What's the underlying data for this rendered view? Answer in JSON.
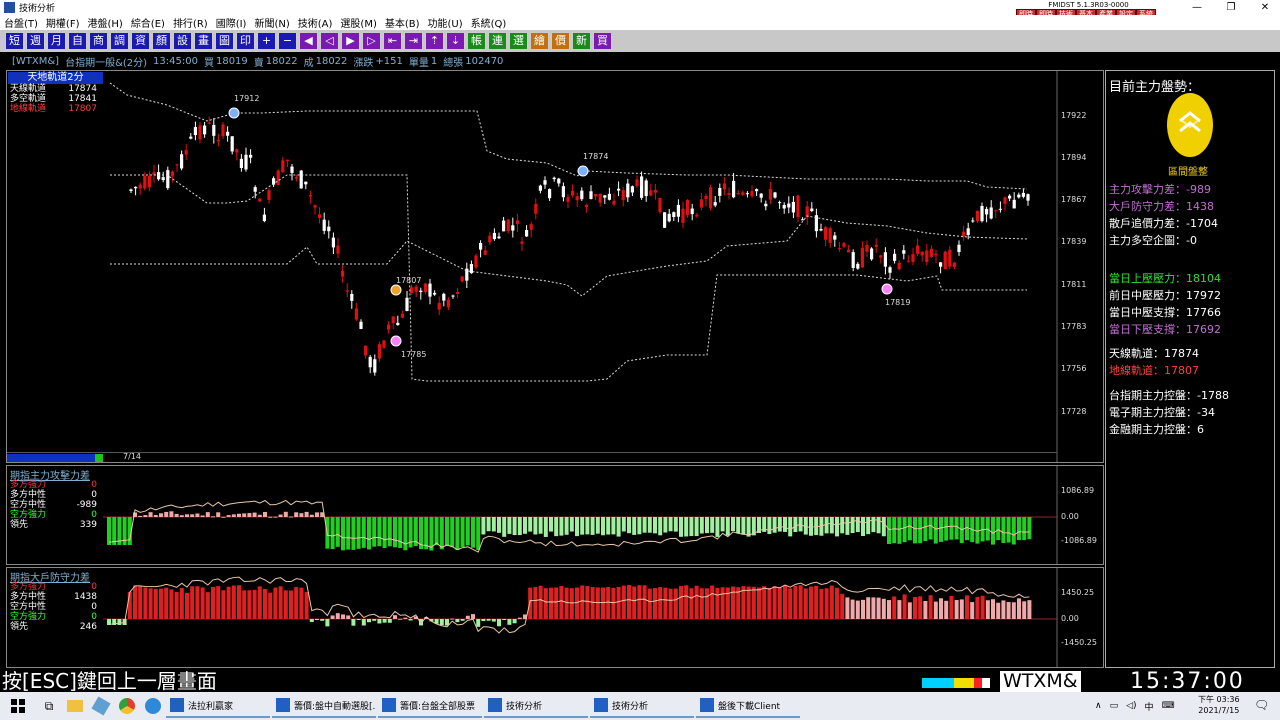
{
  "window": {
    "title": "技術分析",
    "version": "FMIDST 5.1.3R03-0000"
  },
  "quick_buttons": [
    "即時行情",
    "即時新聞",
    "技術分析",
    "基本分析",
    "產業選股",
    "設定說明",
    "系統設定"
  ],
  "menu": [
    "台盤(T)",
    "期權(F)",
    "港盤(H)",
    "綜合(E)",
    "排行(R)",
    "國際(I)",
    "新聞(N)",
    "技術(A)",
    "選股(M)",
    "基本(B)",
    "功能(U)",
    "系統(Q)"
  ],
  "toolbar": [
    "短",
    "週",
    "月",
    "自",
    "商",
    "調",
    "資",
    "顏",
    "設",
    "畫",
    "圖",
    "印",
    "+",
    "−",
    "◀",
    "◁",
    "▶",
    "▷",
    "⇤",
    "⇥",
    "⇡",
    "⇣",
    "帳",
    "連",
    "選",
    "繪",
    "價",
    "新",
    "買"
  ],
  "info": {
    "symbol": "[WTXM&]",
    "name": "台指期一般&(2分)",
    "time": "13:45:00",
    "buy_label": "買",
    "buy": "18019",
    "sell_label": "賣",
    "sell": "18022",
    "deal_label": "成",
    "deal": "18022",
    "change_label": "漲跌",
    "change": "+151",
    "vol_label": "單量",
    "vol": "1",
    "total_label": "總張",
    "total": "102470"
  },
  "main_panel": {
    "title": "天地軌道2分",
    "rows": [
      {
        "label": "天線軌道",
        "value": "17874",
        "color": "#ffffff"
      },
      {
        "label": "多空軌道",
        "value": "17841",
        "color": "#ffffff"
      },
      {
        "label": "地線軌道",
        "value": "17807",
        "color": "#ff4040"
      }
    ],
    "date": "7/14",
    "y_ticks": [
      "17922",
      "17894",
      "17867",
      "17839",
      "17811",
      "17783",
      "17756",
      "17728"
    ],
    "markers": [
      "17912",
      "17874",
      "17807",
      "17785",
      "17819"
    ]
  },
  "panel2": {
    "title": "期指主力攻擊力差",
    "rows": [
      {
        "label": "多方強力",
        "value": "0",
        "color": "#ff3030"
      },
      {
        "label": "多方中性",
        "value": "0",
        "color": "#ffffff"
      },
      {
        "label": "空方中性",
        "value": "-989",
        "color": "#ffffff"
      },
      {
        "label": "空方強力",
        "value": "0",
        "color": "#30ff30"
      },
      {
        "label": "領先",
        "value": "339",
        "color": "#ffffff"
      }
    ],
    "y_ticks": [
      "1086.89",
      "0.00",
      "-1086.89"
    ]
  },
  "panel3": {
    "title": "期指大戶防守力差",
    "rows": [
      {
        "label": "多方強力",
        "value": "0",
        "color": "#ff3030"
      },
      {
        "label": "多方中性",
        "value": "1438",
        "color": "#ffffff"
      },
      {
        "label": "空方中性",
        "value": "0",
        "color": "#ffffff"
      },
      {
        "label": "空方強力",
        "value": "0",
        "color": "#30ff30"
      },
      {
        "label": "領先",
        "value": "246",
        "color": "#ffffff"
      }
    ],
    "y_ticks": [
      "1450.25",
      "0.00",
      "-1450.25"
    ]
  },
  "side": {
    "heading": "目前主力盤勢：",
    "badge": "區間盤整",
    "groups": [
      [
        {
          "text": "主力攻擊力差：-989",
          "color": "#c070d0"
        },
        {
          "text": "大戶防守力差：1438",
          "color": "#c070d0"
        },
        {
          "text": "散戶追價力差：-1704",
          "color": "#ffffff"
        },
        {
          "text": "主力多空企圖：-0",
          "color": "#ffffff"
        }
      ],
      [
        {
          "text": "當日上壓壓力：18104",
          "color": "#30e030"
        },
        {
          "text": "前日中壓壓力：17972",
          "color": "#ffffff"
        },
        {
          "text": "當日中壓支撐：17766",
          "color": "#ffffff"
        },
        {
          "text": "當日下壓支撐：17692",
          "color": "#c070d0"
        }
      ],
      [
        {
          "text": "天線軌道：17874",
          "color": "#ffffff"
        },
        {
          "text": "地線軌道：17807",
          "color": "#ff4040"
        }
      ],
      [
        {
          "text": "台指期主力控盤：-1788",
          "color": "#ffffff"
        },
        {
          "text": "電子期主力控盤：-34",
          "color": "#ffffff"
        },
        {
          "text": "金融期主力控盤：6",
          "color": "#ffffff"
        }
      ]
    ]
  },
  "bottom": {
    "hint": "按[ESC]鍵回上一層畫面",
    "symbol": "WTXM&",
    "clock": "15:37:00"
  },
  "taskbar": {
    "items": [
      "法拉利贏家",
      "籌價:盤中自動選股[...",
      "籌價:台盤全部股票",
      "技術分析",
      "技術分析",
      "盤後下載Client"
    ],
    "time": "下午 03:36",
    "date": "2021/7/15",
    "ime": "中"
  }
}
